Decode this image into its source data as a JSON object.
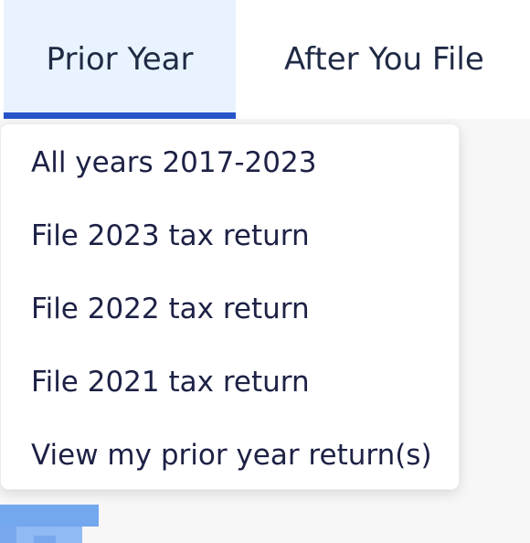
{
  "navigation": {
    "tabs": [
      {
        "label": "Prior Year"
      },
      {
        "label": "After You File"
      }
    ]
  },
  "prior_year_menu": {
    "items": [
      {
        "label": "All years 2017-2023"
      },
      {
        "label": "File 2023 tax return"
      },
      {
        "label": "File 2022 tax return"
      },
      {
        "label": "File 2021 tax return"
      },
      {
        "label": "View my prior year return(s)"
      }
    ]
  },
  "colors": {
    "active_tab_background": "#e9f3ff",
    "active_tab_indicator": "#2754c8",
    "text": "#1d2145",
    "menu_background": "#ffffff",
    "page_background": "#f7f7f7"
  }
}
